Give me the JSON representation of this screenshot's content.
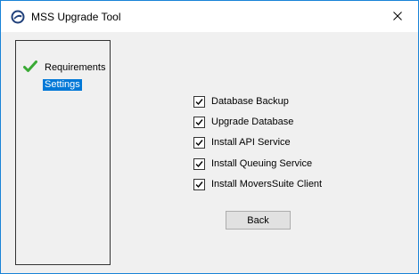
{
  "window": {
    "title": "MSS Upgrade Tool",
    "app_icon": "app-logo-icon",
    "close_icon": "close-icon"
  },
  "steps": [
    {
      "label": "Requirements",
      "status": "complete",
      "icon": "check-icon"
    },
    {
      "label": "Settings",
      "status": "current"
    }
  ],
  "options": [
    {
      "label": "Database Backup",
      "checked": true
    },
    {
      "label": "Upgrade Database",
      "checked": true
    },
    {
      "label": "Install API Service",
      "checked": true
    },
    {
      "label": "Install Queuing Service",
      "checked": true
    },
    {
      "label": "Install MoversSuite Client",
      "checked": true
    }
  ],
  "buttons": {
    "back_label": "Back"
  },
  "colors": {
    "accent": "#0078d7",
    "check_green": "#3aaa35",
    "window_border": "#1883d7"
  }
}
